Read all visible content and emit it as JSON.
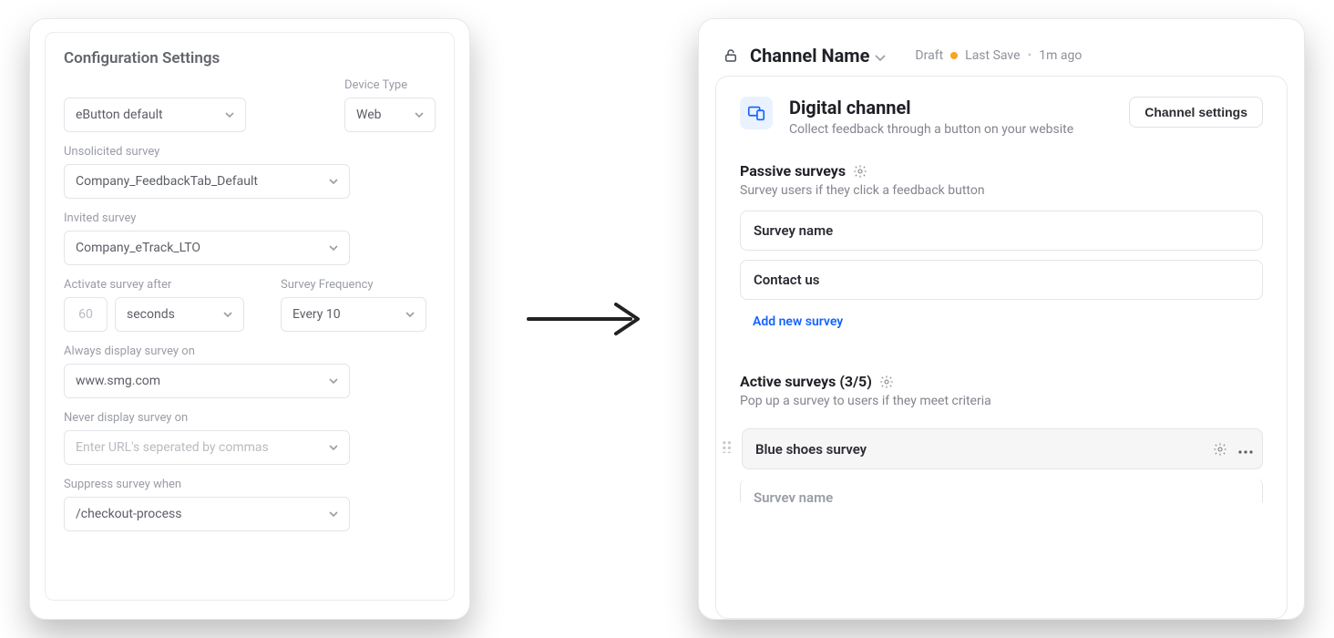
{
  "left": {
    "title": "Configuration Settings",
    "button_default_label": "",
    "button_default_value": "eButton default",
    "device_type_label": "Device Type",
    "device_type_value": "Web",
    "unsolicited_label": "Unsolicited survey",
    "unsolicited_value": "Company_FeedbackTab_Default",
    "invited_label": "Invited survey",
    "invited_value": "Company_eTrack_LTO",
    "activate_label": "Activate survey after",
    "activate_number": "60",
    "activate_unit_value": "seconds",
    "survey_freq_label": "Survey Frequency",
    "survey_freq_value": "Every 10",
    "always_label": "Always display survey on",
    "always_value": "www.smg.com",
    "never_label": "Never display survey on",
    "never_placeholder": "Enter URL's seperated by commas",
    "suppress_label": "Suppress survey when",
    "suppress_value": "/checkout-process"
  },
  "right": {
    "channel_name": "Channel Name",
    "status_draft": "Draft",
    "status_last_save": "Last Save",
    "status_time": "1m ago",
    "card_title": "Digital channel",
    "card_sub": "Collect feedback through a button on your website",
    "settings_btn": "Channel settings",
    "passive_title": "Passive surveys",
    "passive_sub": "Survey users if they click a feedback button",
    "passive_items": {
      "0": "Survey name",
      "1": "Contact us"
    },
    "add_new": "Add new survey",
    "active_title": "Active surveys (3/5)",
    "active_sub": "Pop up a survey to users if they meet criteria",
    "active_items": {
      "0": "Blue shoes survey"
    },
    "ghost_item": "Survey name"
  }
}
